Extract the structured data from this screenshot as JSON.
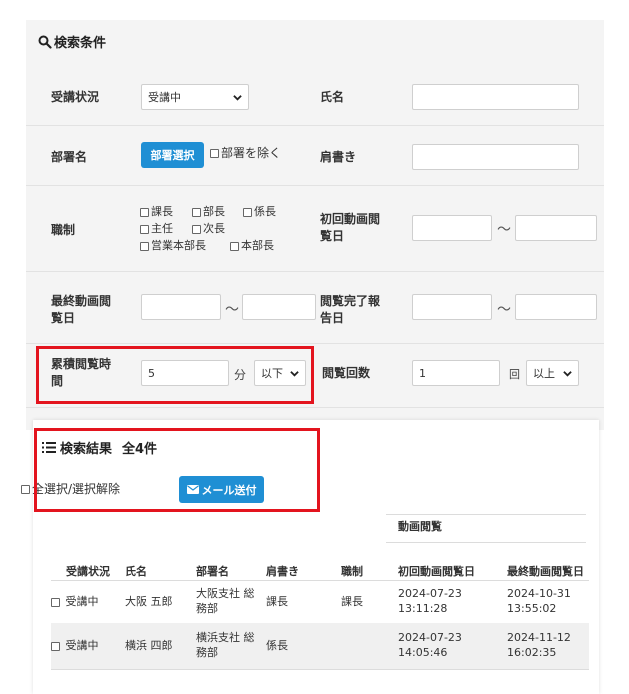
{
  "search": {
    "title": "検索条件",
    "status": {
      "label": "受講状況",
      "value": "受講中"
    },
    "name": {
      "label": "氏名",
      "value": ""
    },
    "dept": {
      "label": "部署名",
      "button": "部署選択",
      "exclude": "部署を除く"
    },
    "title_field": {
      "label": "肩書き",
      "value": ""
    },
    "position": {
      "label": "職制",
      "options": [
        "課長",
        "部長",
        "係長",
        "主任",
        "次長",
        "営業本部長",
        "本部長"
      ]
    },
    "first_view": {
      "label_1": "初回動画閲",
      "label_2": "覧日",
      "from": "",
      "to": "",
      "sep": "～"
    },
    "last_view": {
      "label_1": "最終動画閲",
      "label_2": "覧日",
      "from": "",
      "to": "",
      "sep": "～"
    },
    "complete_report": {
      "label_1": "閲覧完了報",
      "label_2": "告日",
      "from": "",
      "to": "",
      "sep": "～"
    },
    "cumulative": {
      "label_1": "累積閲覧時",
      "label_2": "間",
      "value": "5",
      "unit": "分",
      "cond": "以下"
    },
    "view_count": {
      "label": "閲覧回数",
      "value": "1",
      "unit": "回",
      "cond": "以上"
    }
  },
  "results": {
    "title": "検索結果",
    "count": "全4件",
    "select_all": "全選択/選択解除",
    "mail_button": "メール送付",
    "group_header": "動画閲覧",
    "columns": [
      "受講状況",
      "氏名",
      "部署名",
      "肩書き",
      "職制",
      "初回動画閲覧日",
      "最終動画閲覧日"
    ],
    "rows": [
      {
        "status": "受講中",
        "name": "大阪 五郎",
        "dept_1": "大阪支社 総",
        "dept_2": "務部",
        "title": "課長",
        "position": "課長",
        "first_date": "2024-07-23",
        "first_time": "13:11:28",
        "last_date": "2024-10-31",
        "last_time": "13:55:02"
      },
      {
        "status": "受講中",
        "name": "横浜 四郎",
        "dept_1": "横浜支社 総",
        "dept_2": "務部",
        "title": "係長",
        "position": "",
        "first_date": "2024-07-23",
        "first_time": "14:05:46",
        "last_date": "2024-11-12",
        "last_time": "16:02:35"
      }
    ]
  },
  "colors": {
    "accent": "#1f8fd4",
    "highlight": "#e3141e",
    "panel_bg": "#f4f4f4"
  }
}
